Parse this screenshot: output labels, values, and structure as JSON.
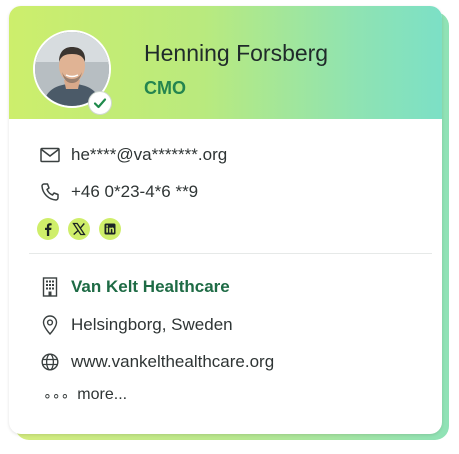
{
  "profile": {
    "name": "Henning Forsberg",
    "title": "CMO",
    "verified": true
  },
  "contact": {
    "email": "he****@va*******.org",
    "phone": "+46 0*23-4*6 **9",
    "socials": [
      "facebook-icon",
      "x-icon",
      "linkedin-icon"
    ]
  },
  "company": {
    "name": "Van Kelt Healthcare",
    "location": "Helsingborg, Sweden",
    "website": "www.vankelthealthcare.org"
  },
  "more_label": "more...",
  "more_dots": "∘∘∘",
  "colors": {
    "accent_green": "#24854f",
    "company_green": "#1e6b45",
    "social_bg": "#cfee6a"
  }
}
